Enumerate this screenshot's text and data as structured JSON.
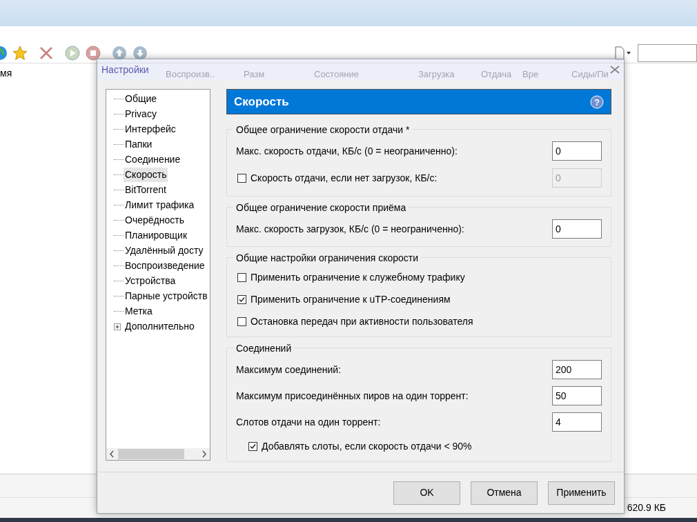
{
  "background": {
    "list_header": "мя",
    "columns": [
      "Воспроизв..",
      "Разм",
      "Состояние",
      "Загрузка",
      "Отдача",
      "Вре",
      "Сиды/Пи"
    ],
    "status": "620.9 КБ"
  },
  "dialog": {
    "title": "Настройки",
    "tree": [
      {
        "label": "Общие",
        "selected": false
      },
      {
        "label": "Privacy",
        "selected": false
      },
      {
        "label": "Интерфейс",
        "selected": false
      },
      {
        "label": "Папки",
        "selected": false
      },
      {
        "label": "Соединение",
        "selected": false
      },
      {
        "label": "Скорость",
        "selected": true
      },
      {
        "label": "BitTorrent",
        "selected": false
      },
      {
        "label": "Лимит трафика",
        "selected": false
      },
      {
        "label": "Очерёдность",
        "selected": false
      },
      {
        "label": "Планировщик",
        "selected": false
      },
      {
        "label": "Удалённый досту",
        "selected": false
      },
      {
        "label": "Воспроизведение",
        "selected": false
      },
      {
        "label": "Устройства",
        "selected": false
      },
      {
        "label": "Парные устройств",
        "selected": false
      },
      {
        "label": "Метка",
        "selected": false
      },
      {
        "label": "Дополнительно",
        "selected": false,
        "expanded": false
      }
    ],
    "page_title": "Скорость",
    "help": "?",
    "groups": [
      {
        "title": "Общее ограничение скорости отдачи *",
        "rows": [
          {
            "kind": "field",
            "label": "Макс. скорость отдачи, КБ/с (0 = неограниченно):",
            "value": "0",
            "disabled": false
          },
          {
            "kind": "checkfield",
            "label": "Скорость отдачи, если нет загрузок, КБ/с:",
            "checked": false,
            "value": "0",
            "disabled": true
          }
        ]
      },
      {
        "title": "Общее ограничение скорости приёма",
        "rows": [
          {
            "kind": "field",
            "label": "Макс. скорость загрузок, КБ/с (0 = неограниченно):",
            "value": "0",
            "disabled": false
          }
        ]
      },
      {
        "title": "Общие настройки ограничения скорости",
        "rows": [
          {
            "kind": "checkbox",
            "label": "Применить ограничение к служебному трафику",
            "checked": false
          },
          {
            "kind": "checkbox",
            "label": "Применить ограничение к uTP-соединениям",
            "checked": true
          },
          {
            "kind": "checkbox",
            "label": "Остановка передач при активности пользователя",
            "checked": false
          }
        ]
      },
      {
        "title": "Соединений",
        "rows": [
          {
            "kind": "field",
            "label": "Максимум соединений:",
            "value": "200",
            "disabled": false
          },
          {
            "kind": "field",
            "label": "Максимум присоединённых пиров на один торрент:",
            "value": "50",
            "disabled": false
          },
          {
            "kind": "field",
            "label": "Слотов отдачи на один торрент:",
            "value": "4",
            "disabled": false
          },
          {
            "kind": "subcheckbox",
            "label": "Добавлять слоты, если скорость отдачи < 90%",
            "checked": true
          }
        ]
      }
    ],
    "buttons": [
      "OK",
      "Отмена",
      "Применить"
    ]
  }
}
